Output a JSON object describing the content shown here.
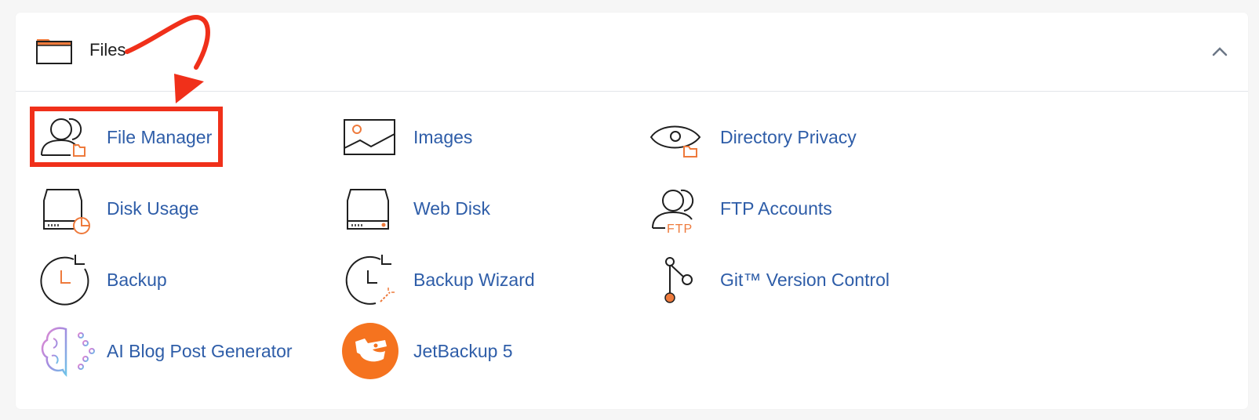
{
  "colors": {
    "link": "#2e5da8",
    "accent_orange": "#ee7a3c",
    "highlight_red": "#f0301a",
    "panel_bg": "#ffffff",
    "page_bg": "#f6f6f6"
  },
  "section": {
    "title": "Files",
    "icon": "folder-icon",
    "collapse_icon": "chevron-up-icon"
  },
  "items": [
    {
      "label": "File Manager",
      "icon": "user-folder-icon"
    },
    {
      "label": "Images",
      "icon": "image-icon"
    },
    {
      "label": "Directory Privacy",
      "icon": "eye-folder-icon"
    },
    {
      "label": "Disk Usage",
      "icon": "disk-chart-icon"
    },
    {
      "label": "Web Disk",
      "icon": "drive-icon"
    },
    {
      "label": "FTP Accounts",
      "icon": "user-ftp-icon",
      "icon_text": "FTP"
    },
    {
      "label": "Backup",
      "icon": "clock-arrow-icon"
    },
    {
      "label": "Backup Wizard",
      "icon": "clock-wand-icon"
    },
    {
      "label": "Git™ Version Control",
      "icon": "git-branch-icon"
    },
    {
      "label": "AI Blog Post Generator",
      "icon": "brain-circuit-icon"
    },
    {
      "label": "JetBackup 5",
      "icon": "jetbackup-logo-icon"
    }
  ],
  "annotation": {
    "highlighted_item": "File Manager",
    "arrow": "red-arrow-icon"
  }
}
